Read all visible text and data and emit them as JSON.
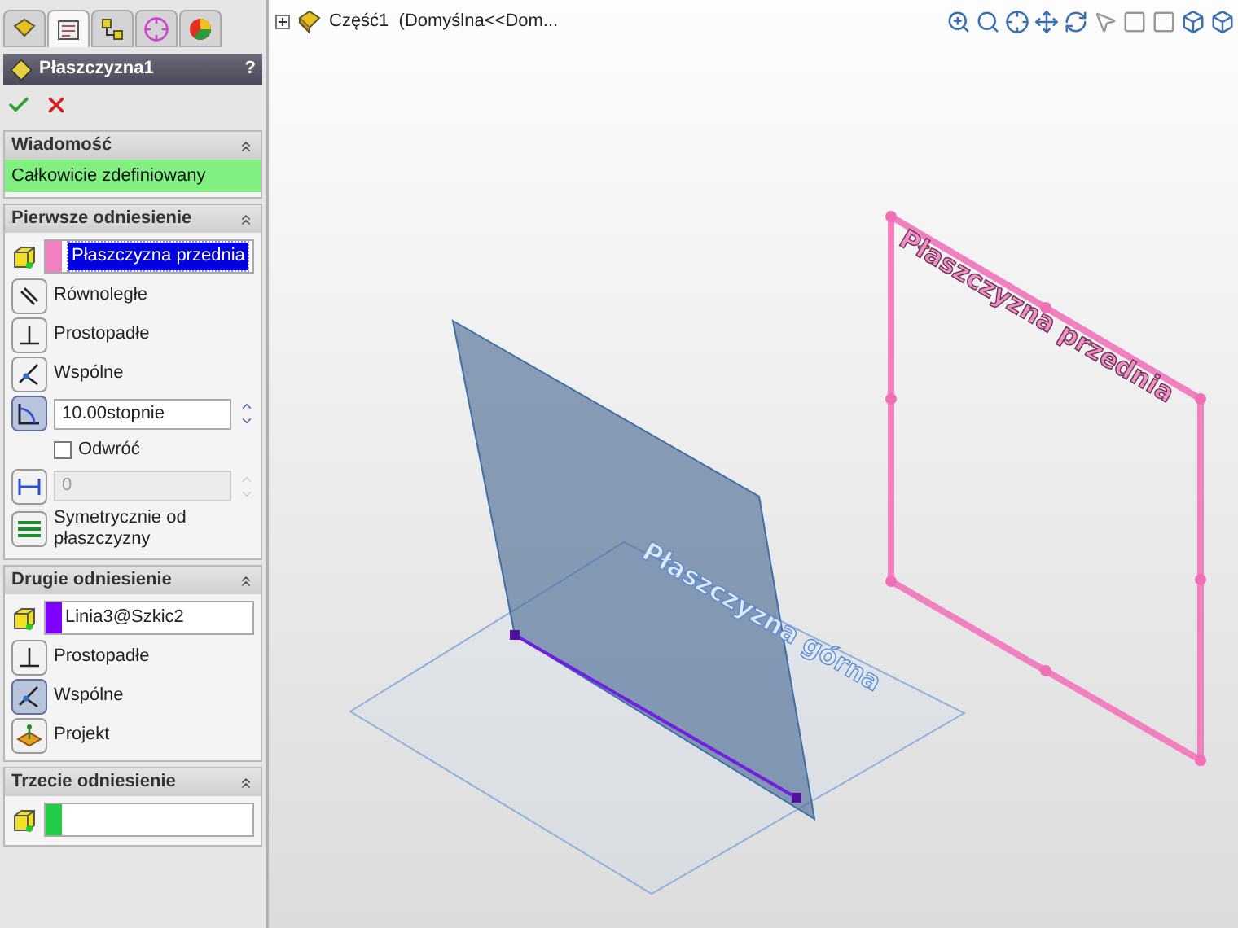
{
  "property_manager": {
    "tabs": [
      {
        "selected": false
      },
      {
        "selected": true
      },
      {
        "selected": false
      },
      {
        "selected": false
      },
      {
        "selected": false
      }
    ],
    "title": "Płaszczyzna1",
    "help": "?",
    "sections": [
      {
        "title": "Wiadomość",
        "message": "Całkowicie zdefiniowany"
      },
      {
        "title": "Pierwsze odniesienie",
        "reference": {
          "value": "Płaszczyzna przednia",
          "color": "#f080c0",
          "selected": true
        },
        "rows": [
          {
            "kind": "parallel",
            "label": "Równoległe",
            "selected": false
          },
          {
            "kind": "perpendicular",
            "label": "Prostopadłe",
            "selected": false
          },
          {
            "kind": "coincident",
            "label": "Wspólne",
            "selected": false
          },
          {
            "kind": "angle",
            "value": "10.00stopnie",
            "selected": true,
            "disabled": false
          },
          {
            "kind": "checkbox",
            "label": "Odwróć",
            "checked": false
          },
          {
            "kind": "distance",
            "value": "0",
            "selected": false,
            "disabled": true
          },
          {
            "kind": "midplane",
            "label": "Symetrycznie od płaszczyzny",
            "selected": false
          }
        ]
      },
      {
        "title": "Drugie odniesienie",
        "reference": {
          "value": "Linia3@Szkic2",
          "color": "#8000ff",
          "selected": false
        },
        "rows": [
          {
            "kind": "perpendicular",
            "label": "Prostopadłe",
            "selected": false
          },
          {
            "kind": "coincident",
            "label": "Wspólne",
            "selected": true
          },
          {
            "kind": "project",
            "label": "Projekt",
            "selected": false
          }
        ]
      },
      {
        "title": "Trzecie odniesienie",
        "reference": {
          "color": "#22cc44"
        }
      }
    ]
  },
  "tree": {
    "label": "Część1  (Domyślna<<Dom..."
  },
  "viewport": {
    "front_plane_label": "Płaszczyzna przednia",
    "top_plane_label": "Płaszczyzna górna"
  }
}
